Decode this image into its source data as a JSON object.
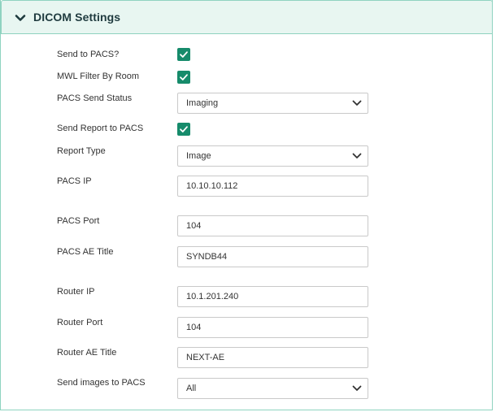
{
  "panel": {
    "title": "DICOM Settings",
    "accent_color": "#168b6b",
    "header_bg": "#e8f6f1"
  },
  "fields": {
    "send_to_pacs": {
      "label": "Send to PACS?",
      "checked": true
    },
    "mwl_filter_by_room": {
      "label": "MWL Filter By Room",
      "checked": true
    },
    "pacs_send_status": {
      "label": "PACS Send Status",
      "value": "Imaging"
    },
    "send_report_to_pacs": {
      "label": "Send Report to PACS",
      "checked": true
    },
    "report_type": {
      "label": "Report Type",
      "value": "Image"
    },
    "pacs_ip": {
      "label": "PACS IP",
      "value": "10.10.10.112"
    },
    "pacs_port": {
      "label": "PACS Port",
      "value": "104"
    },
    "pacs_ae_title": {
      "label": "PACS AE Title",
      "value": "SYNDB44"
    },
    "router_ip": {
      "label": "Router IP",
      "value": "10.1.201.240"
    },
    "router_port": {
      "label": "Router Port",
      "value": "104"
    },
    "router_ae_title": {
      "label": "Router AE Title",
      "value": "NEXT-AE"
    },
    "send_images_to_pacs": {
      "label": "Send images to PACS",
      "value": "All"
    }
  },
  "icons": {
    "collapse": "chevron-down-icon",
    "check": "checkmark-icon",
    "dropdown": "chevron-down-icon"
  }
}
